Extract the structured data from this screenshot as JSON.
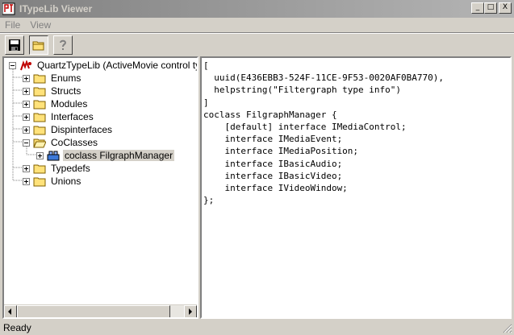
{
  "window": {
    "title": "ITypeLib Viewer",
    "minimize_label": "_",
    "maximize_label": "□",
    "close_label": "X"
  },
  "menu": [
    "File",
    "View"
  ],
  "toolbar": {
    "buttons": [
      "save-icon",
      "folder-icon",
      "help-icon"
    ]
  },
  "tree": {
    "root": "QuartzTypeLib (ActiveMovie control type",
    "items": [
      "Enums",
      "Structs",
      "Modules",
      "Interfaces",
      "Dispinterfaces",
      "CoClasses",
      "Typedefs",
      "Unions"
    ],
    "selected_child": "coclass FilgraphManager"
  },
  "idl_lines": [
    "[",
    "  uuid(E436EBB3-524F-11CE-9F53-0020AF0BA770),",
    "  helpstring(\"Filtergraph type info\")",
    "]",
    "coclass FilgraphManager {",
    "    [default] interface IMediaControl;",
    "    interface IMediaEvent;",
    "    interface IMediaPosition;",
    "    interface IBasicAudio;",
    "    interface IBasicVideo;",
    "    interface IVideoWindow;",
    "};"
  ],
  "status": "Ready",
  "colors": {
    "face": "#d4d0c8",
    "title_gradient_start": "#808080",
    "title_gradient_end": "#b5b5b5",
    "folder_yellow": "#ffe27a"
  }
}
